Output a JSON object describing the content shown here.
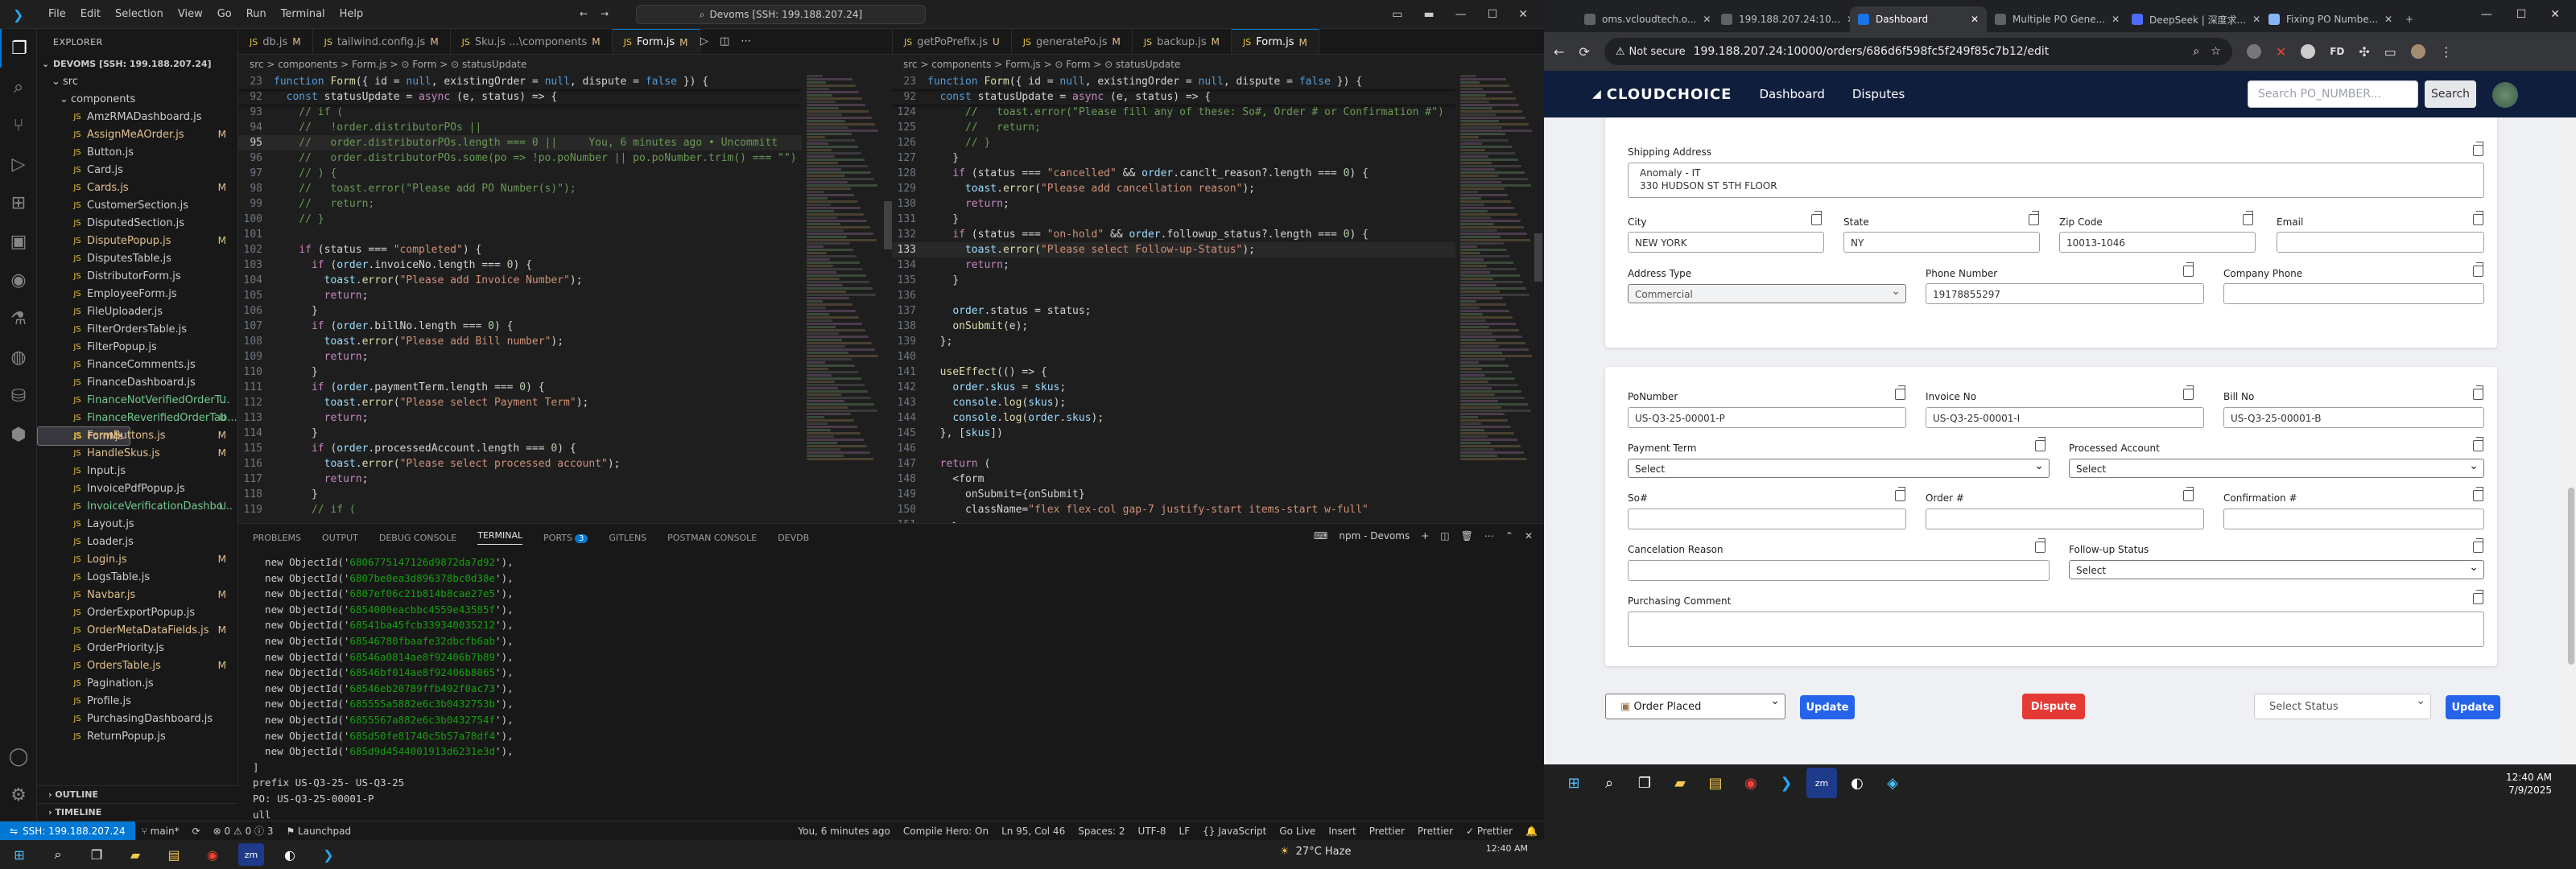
{
  "vscode": {
    "menu": [
      "File",
      "Edit",
      "Selection",
      "View",
      "Go",
      "Run",
      "Terminal",
      "Help"
    ],
    "command_center": "Devoms [SSH: 199.188.207.24]",
    "explorer": {
      "title": "EXPLORER",
      "root": "DEVOMS [SSH: 199.188.207.24]",
      "folders": [
        "src",
        "components"
      ],
      "files": [
        {
          "name": "AmzRMADashboard.js",
          "status": ""
        },
        {
          "name": "AssignMeAOrder.js",
          "status": "M"
        },
        {
          "name": "Button.js",
          "status": ""
        },
        {
          "name": "Card.js",
          "status": ""
        },
        {
          "name": "Cards.js",
          "status": "M"
        },
        {
          "name": "CustomerSection.js",
          "status": ""
        },
        {
          "name": "DisputedSection.js",
          "status": ""
        },
        {
          "name": "DisputePopup.js",
          "status": "M"
        },
        {
          "name": "DisputesTable.js",
          "status": ""
        },
        {
          "name": "DistributorForm.js",
          "status": ""
        },
        {
          "name": "EmployeeForm.js",
          "status": ""
        },
        {
          "name": "FileUploader.js",
          "status": ""
        },
        {
          "name": "FilterOrdersTable.js",
          "status": ""
        },
        {
          "name": "FilterPopup.js",
          "status": ""
        },
        {
          "name": "FinanceComments.js",
          "status": ""
        },
        {
          "name": "FinanceDashboard.js",
          "status": ""
        },
        {
          "name": "FinanceNotVerifiedOrderT...",
          "status": "U"
        },
        {
          "name": "FinanceReverifiedOrderTab...",
          "status": "U"
        },
        {
          "name": "Form.js",
          "status": "M"
        },
        {
          "name": "FormButtons.js",
          "status": "M"
        },
        {
          "name": "HandleSkus.js",
          "status": "M"
        },
        {
          "name": "Input.js",
          "status": ""
        },
        {
          "name": "InvoicePdfPopup.js",
          "status": ""
        },
        {
          "name": "InvoiceVerificationDashbo...",
          "status": "U"
        },
        {
          "name": "Layout.js",
          "status": ""
        },
        {
          "name": "Loader.js",
          "status": ""
        },
        {
          "name": "Login.js",
          "status": "M"
        },
        {
          "name": "LogsTable.js",
          "status": ""
        },
        {
          "name": "Navbar.js",
          "status": "M"
        },
        {
          "name": "OrderExportPopup.js",
          "status": ""
        },
        {
          "name": "OrderMetaDataFields.js",
          "status": "M"
        },
        {
          "name": "OrderPriority.js",
          "status": ""
        },
        {
          "name": "OrdersTable.js",
          "status": "M"
        },
        {
          "name": "Pagination.js",
          "status": ""
        },
        {
          "name": "Profile.js",
          "status": ""
        },
        {
          "name": "PurchasingDashboard.js",
          "status": ""
        },
        {
          "name": "ReturnPopup.js",
          "status": ""
        }
      ],
      "outline": "OUTLINE",
      "timeline": "TIMELINE"
    },
    "tabs_left": [
      {
        "name": "db.js",
        "mark": "M",
        "active": false
      },
      {
        "name": "tailwind.config.js",
        "mark": "M",
        "active": false
      },
      {
        "name": "Sku.js ...\\components",
        "mark": "M",
        "active": false
      },
      {
        "name": "Form.js",
        "mark": "M",
        "active": true
      }
    ],
    "tabs_right": [
      {
        "name": "getPoPrefix.js",
        "mark": "U",
        "active": false
      },
      {
        "name": "generatePo.js",
        "mark": "M",
        "active": false
      },
      {
        "name": "backup.js",
        "mark": "M",
        "active": false
      },
      {
        "name": "Form.js",
        "mark": "M",
        "active": true
      }
    ],
    "breadcrumb_left": "src > components > Form.js > ⊙ Form > ⊙ statusUpdate",
    "breadcrumb_right": "src > components > Form.js > ⊙ Form > ⊙ statusUpdate",
    "editor_left": {
      "lines": [
        {
          "n": "23",
          "t": "function Form({ id = null, existingOrder = null, dispute = false }) {"
        },
        {
          "n": "92",
          "t": "  const statusUpdate = async (e, status) => {"
        },
        {
          "n": "93",
          "t": "    // if ("
        },
        {
          "n": "94",
          "t": "    //   !order.distributorPOs ||"
        },
        {
          "n": "95",
          "t": "    //   order.distributorPOs.length === 0 ||     You, 6 minutes ago • Uncommitt"
        },
        {
          "n": "96",
          "t": "    //   order.distributorPOs.some(po => !po.poNumber || po.poNumber.trim() === \"\")"
        },
        {
          "n": "97",
          "t": "    // ) {"
        },
        {
          "n": "98",
          "t": "    //   toast.error(\"Please add PO Number(s)\");"
        },
        {
          "n": "99",
          "t": "    //   return;"
        },
        {
          "n": "100",
          "t": "    // }"
        },
        {
          "n": "101",
          "t": ""
        },
        {
          "n": "102",
          "t": "    if (status === \"completed\") {"
        },
        {
          "n": "103",
          "t": "      if (order.invoiceNo.length === 0) {"
        },
        {
          "n": "104",
          "t": "        toast.error(\"Please add Invoice Number\");"
        },
        {
          "n": "105",
          "t": "        return;"
        },
        {
          "n": "106",
          "t": "      }"
        },
        {
          "n": "107",
          "t": "      if (order.billNo.length === 0) {"
        },
        {
          "n": "108",
          "t": "        toast.error(\"Please add Bill number\");"
        },
        {
          "n": "109",
          "t": "        return;"
        },
        {
          "n": "110",
          "t": "      }"
        },
        {
          "n": "111",
          "t": "      if (order.paymentTerm.length === 0) {"
        },
        {
          "n": "112",
          "t": "        toast.error(\"Please select Payment Term\");"
        },
        {
          "n": "113",
          "t": "        return;"
        },
        {
          "n": "114",
          "t": "      }"
        },
        {
          "n": "115",
          "t": "      if (order.processedAccount.length === 0) {"
        },
        {
          "n": "116",
          "t": "        toast.error(\"Please select processed account\");"
        },
        {
          "n": "117",
          "t": "        return;"
        },
        {
          "n": "118",
          "t": "      }"
        },
        {
          "n": "119",
          "t": "      // if ("
        }
      ],
      "current_line": "95"
    },
    "editor_right": {
      "lines": [
        {
          "n": "23",
          "t": "function Form({ id = null, existingOrder = null, dispute = false }) {"
        },
        {
          "n": "92",
          "t": "  const statusUpdate = async (e, status) => {"
        },
        {
          "n": "124",
          "t": "      //   toast.error(\"Please fill any of these: So#, Order # or Confirmation #\")"
        },
        {
          "n": "125",
          "t": "      //   return;"
        },
        {
          "n": "126",
          "t": "      // }"
        },
        {
          "n": "127",
          "t": "    }"
        },
        {
          "n": "128",
          "t": "    if (status === \"cancelled\" && order.canclt_reason?.length === 0) {"
        },
        {
          "n": "129",
          "t": "      toast.error(\"Please add cancellation reason\");"
        },
        {
          "n": "130",
          "t": "      return;"
        },
        {
          "n": "131",
          "t": "    }"
        },
        {
          "n": "132",
          "t": "    if (status === \"on-hold\" && order.followup_status?.length === 0) {"
        },
        {
          "n": "133",
          "t": "      toast.error(\"Please select Follow-up-Status\");"
        },
        {
          "n": "134",
          "t": "      return;"
        },
        {
          "n": "135",
          "t": "    }"
        },
        {
          "n": "136",
          "t": ""
        },
        {
          "n": "137",
          "t": "    order.status = status;"
        },
        {
          "n": "138",
          "t": "    onSubmit(e);"
        },
        {
          "n": "139",
          "t": "  };"
        },
        {
          "n": "140",
          "t": ""
        },
        {
          "n": "141",
          "t": "  useEffect(() => {"
        },
        {
          "n": "142",
          "t": "    order.skus = skus;"
        },
        {
          "n": "143",
          "t": "    console.log(skus);"
        },
        {
          "n": "144",
          "t": "    console.log(order.skus);"
        },
        {
          "n": "145",
          "t": "  }, [skus])"
        },
        {
          "n": "146",
          "t": ""
        },
        {
          "n": "147",
          "t": "  return ("
        },
        {
          "n": "148",
          "t": "    <form"
        },
        {
          "n": "149",
          "t": "      onSubmit={onSubmit}"
        },
        {
          "n": "150",
          "t": "      className=\"flex flex-col gap-7 justify-start items-start w-full\""
        },
        {
          "n": "151",
          "t": "    >"
        }
      ],
      "current_line": "133"
    },
    "panel": {
      "tabs": [
        "PROBLEMS",
        "OUTPUT",
        "DEBUG CONSOLE",
        "TERMINAL",
        "PORTS",
        "GITLENS",
        "POSTMAN CONSOLE",
        "DEVDB"
      ],
      "active": "TERMINAL",
      "ports_badge": "3",
      "terminal_name": "npm - Devoms",
      "object_ids": [
        "6806775147126d9872da7d92",
        "6807be0ea3d896378bc0d38e",
        "6807ef06c21b814b8cae27e5",
        "6854000eacbbc4559e43585f",
        "68541ba45fcb339340035212",
        "68546780fbaafe32dbcfb6ab",
        "68546a0814ae8f92406b7b89",
        "68546bf014ae8f92406b8065",
        "68546eb20789ffb492f0ac73",
        "685555a5882e6c3b0432753b",
        "6855567a882e6c3b0432754f",
        "685d50fe81740c5b57a78df4",
        "685d9d4544001913d6231e3d"
      ],
      "after_lines": [
        "]",
        "prefix US-Q3-25- US-Q3-25",
        "PO: US-Q3-25-00001-P",
        "ull"
      ]
    },
    "statusbar": {
      "remote": "SSH: 199.188.207.24",
      "branch": "main*",
      "problems": "⊗ 0 ⚠ 0  ⓘ 3",
      "launchpad": "Launchpad",
      "blame": "You, 6 minutes ago",
      "compile": "Compile Hero: On",
      "position": "Ln 95, Col 46",
      "spaces": "Spaces: 2",
      "encoding": "UTF-8",
      "eol": "LF",
      "lang": "{} JavaScript",
      "golive": "Go Live",
      "insert": "Insert",
      "prettier": "Prettier",
      "prettier2": "Prettier",
      "prettier3": "✓ Prettier"
    },
    "weather": "27°C  Haze"
  },
  "chrome": {
    "tabs": [
      {
        "title": "oms.vcloudtech.o...",
        "active": false,
        "color": "#5f6368"
      },
      {
        "title": "199.188.207.24:10...",
        "active": false,
        "color": "#5f6368"
      },
      {
        "title": "Dashboard",
        "active": true,
        "color": "#1a73e8"
      },
      {
        "title": "Multiple PO Gene...",
        "active": false,
        "color": "#5f6368"
      },
      {
        "title": "DeepSeek | 深度求...",
        "active": false,
        "color": "#4d6bfe"
      },
      {
        "title": "Fixing PO Numbe...",
        "active": false,
        "color": "#8ab4f8"
      }
    ],
    "not_secure": "Not secure",
    "url": "199.188.207.24:10000/orders/686d6f598fc5f249f85c7b12/edit",
    "app": {
      "logo": "CLOUDCHOICE",
      "nav": [
        "Dashboard",
        "Disputes"
      ],
      "search_placeholder": "Search PO_NUMBER...",
      "search_button": "Search"
    },
    "address_card": {
      "shipping_label": "Shipping Address",
      "shipping_value_1": "Anomaly - IT",
      "shipping_value_2": "330 HUDSON ST 5TH FLOOR",
      "city_label": "City",
      "city_value": "NEW YORK",
      "state_label": "State",
      "state_value": "NY",
      "zip_label": "Zip Code",
      "zip_value": "10013-1046",
      "email_label": "Email",
      "email_value": "",
      "addr_type_label": "Address Type",
      "addr_type_value": "Commercial",
      "phone_label": "Phone Number",
      "phone_value": "19178855297",
      "company_phone_label": "Company Phone",
      "company_phone_value": ""
    },
    "po_card": {
      "po_label": "PoNumber",
      "po_value": "US-Q3-25-00001-P",
      "invoice_label": "Invoice No",
      "invoice_value": "US-Q3-25-00001-I",
      "bill_label": "Bill No",
      "bill_value": "US-Q3-25-00001-B",
      "payment_label": "Payment Term",
      "payment_value": "Select",
      "processed_label": "Processed Account",
      "processed_value": "Select",
      "so_label": "So#",
      "order_label": "Order #",
      "confirm_label": "Confirmation #",
      "cancel_label": "Cancelation Reason",
      "followup_label": "Follow-up Status",
      "followup_value": "Select",
      "comment_label": "Purchasing Comment"
    },
    "actions": {
      "status_value": "Order Placed",
      "update_1": "Update",
      "dispute": "Dispute",
      "select_status": "Select Status",
      "update_2": "Update"
    },
    "clock_time": "12:40 AM",
    "clock_date": "7/9/2025"
  }
}
